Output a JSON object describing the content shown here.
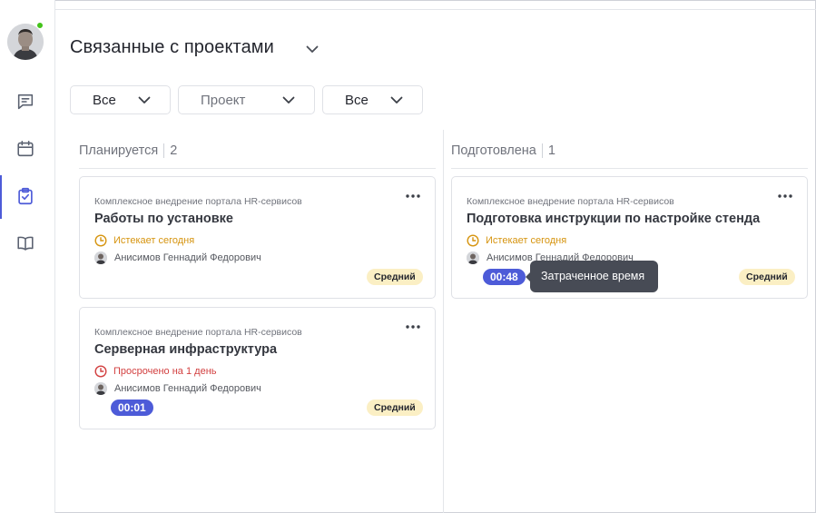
{
  "header": {
    "title": "Связанные с проектами"
  },
  "filters": [
    {
      "label": "Все",
      "is_placeholder": false
    },
    {
      "label": "Проект",
      "is_placeholder": true
    },
    {
      "label": "Все",
      "is_placeholder": false
    }
  ],
  "columns": [
    {
      "name": "Планируется",
      "count": "2",
      "cards": [
        {
          "project": "Комплексное внедрение портала HR-сервисов",
          "title": "Работы по установке",
          "deadline": "Истекает сегодня",
          "deadline_status": "warning",
          "assignee": "Анисимов Геннадий Федорович",
          "timer": "",
          "priority": "Средний"
        },
        {
          "project": "Комплексное внедрение портала HR-сервисов",
          "title": "Серверная инфраструктура",
          "deadline": "Просрочено на 1 день",
          "deadline_status": "overdue",
          "assignee": "Анисимов Геннадий Федорович",
          "timer": "00:01",
          "priority": "Средний"
        }
      ]
    },
    {
      "name": "Подготовлена",
      "count": "1",
      "cards": [
        {
          "project": "Комплексное внедрение портала HR-сервисов",
          "title": "Подготовка инструкции по настройке стенда",
          "deadline": "Истекает сегодня",
          "deadline_status": "warning",
          "assignee": "Анисимов Геннадий Федорович",
          "timer": "00:48",
          "priority": "Средний"
        }
      ]
    }
  ],
  "tooltip": {
    "text": "Затраченное время"
  },
  "icons": {
    "sidebar": [
      "chat-icon",
      "calendar-icon",
      "tasks-icon",
      "book-icon"
    ],
    "active": "tasks-icon"
  },
  "colors": {
    "accent": "#4d5bd8",
    "warning": "#d6940f",
    "overdue": "#d23f3f",
    "priority_badge": "#fbefc4",
    "online": "#43c31a",
    "tooltip_bg": "#474b55"
  }
}
